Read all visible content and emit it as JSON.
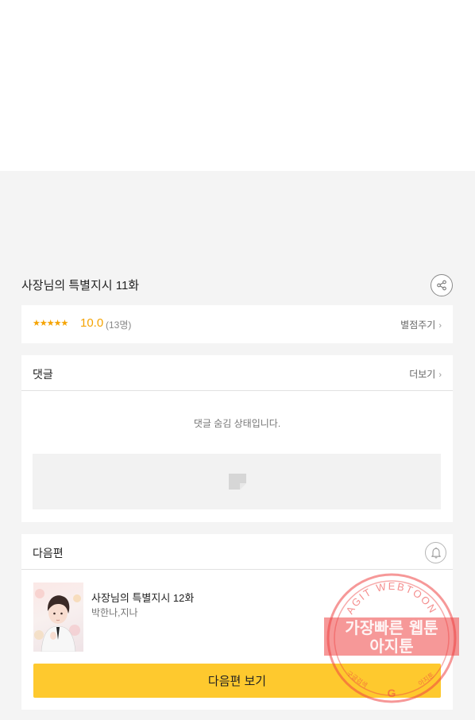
{
  "episode": {
    "title": "사장님의 특별지시 11화"
  },
  "rating": {
    "stars": "★★★★★",
    "score": "10.0",
    "count": "(13명)",
    "rate_link": "별점주기"
  },
  "comments": {
    "title": "댓글",
    "more_link": "더보기",
    "hidden_message": "댓글 숨김 상태입니다."
  },
  "next_episode": {
    "section_title": "다음편",
    "title": "사장님의 특별지시 12화",
    "author": "박한나,지나",
    "button_label": "다음편 보기"
  },
  "watermark": {
    "arc_text": "AGIT WEBTOON",
    "line1": "가장빠른 웹툰",
    "line2": "아지툰",
    "bottom_left": "구글검색",
    "bottom_right": "아지툰",
    "bottom_letter": "G"
  },
  "colors": {
    "accent_star": "#f5a300",
    "button_yellow": "#fec92e",
    "watermark_red": "#ee4444",
    "background_gray": "#f4f4f4"
  },
  "icons": {
    "share": "share-icon",
    "bell": "bell-icon",
    "chevron": "chevron-right-icon",
    "placeholder": "image-placeholder-icon"
  }
}
